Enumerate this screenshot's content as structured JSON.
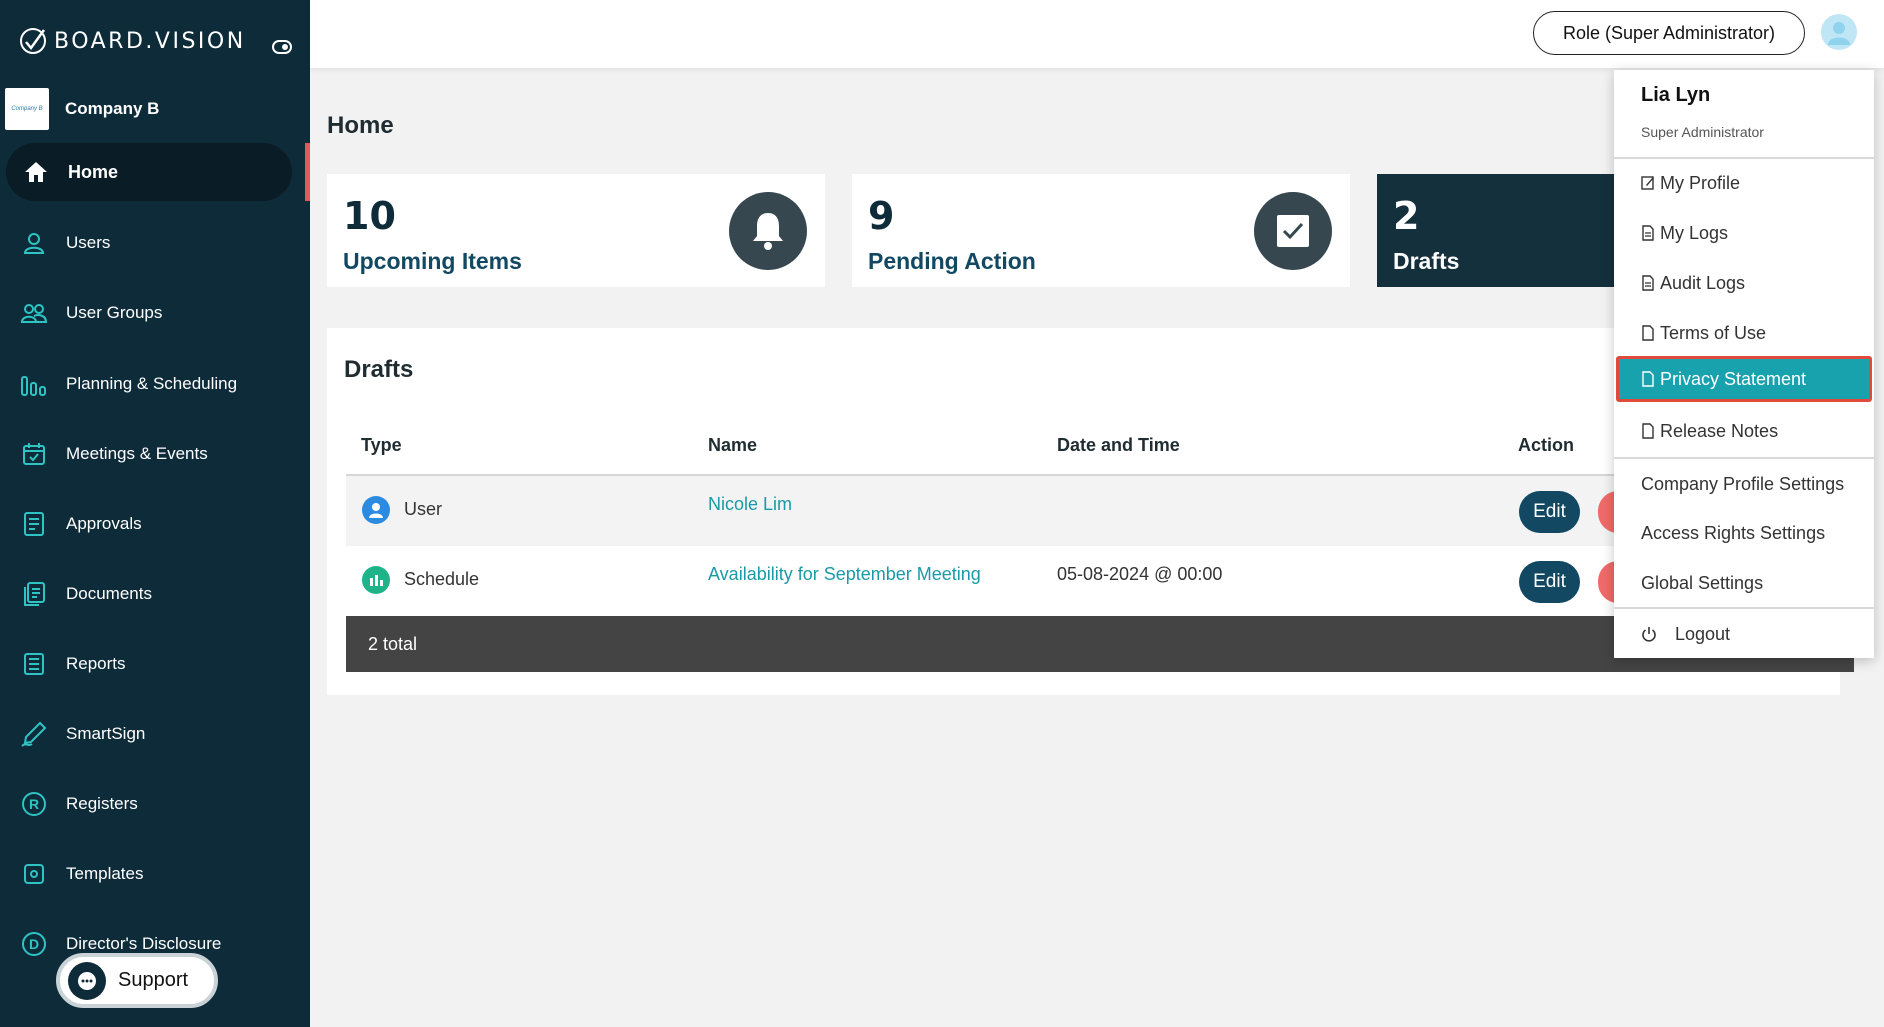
{
  "sidebar": {
    "brand": "BOARD.VISION",
    "company": {
      "logo_text": "Company B",
      "name": "Company B"
    },
    "items": [
      {
        "label": "Home",
        "icon": "home-icon"
      },
      {
        "label": "Users",
        "icon": "user-icon"
      },
      {
        "label": "User Groups",
        "icon": "user-group-icon"
      },
      {
        "label": "Planning & Scheduling",
        "icon": "bar-chart-icon"
      },
      {
        "label": "Meetings & Events",
        "icon": "calendar-icon"
      },
      {
        "label": "Approvals",
        "icon": "approvals-icon"
      },
      {
        "label": "Documents",
        "icon": "documents-icon"
      },
      {
        "label": "Reports",
        "icon": "reports-icon"
      },
      {
        "label": "SmartSign",
        "icon": "pen-icon"
      },
      {
        "label": "Registers",
        "icon": "registers-icon"
      },
      {
        "label": "Templates",
        "icon": "templates-icon"
      },
      {
        "label": "Director's Disclosure",
        "icon": "disclosure-icon"
      }
    ],
    "support_label": "Support"
  },
  "header": {
    "role_label": "Role (Super Administrator)"
  },
  "main": {
    "page_title": "Home",
    "cards": [
      {
        "value": "10",
        "label": "Upcoming Items",
        "icon": "bell-icon"
      },
      {
        "value": "9",
        "label": "Pending Action",
        "icon": "check-icon"
      },
      {
        "value": "2",
        "label": "Drafts"
      }
    ],
    "drafts": {
      "title": "Drafts",
      "columns": [
        "Type",
        "Name",
        "Date and Time",
        "Action"
      ],
      "rows": [
        {
          "type": "User",
          "name": "Nicole Lim",
          "datetime": "",
          "edit": "Edit"
        },
        {
          "type": "Schedule",
          "name": "Availability for September Meeting",
          "datetime": "05-08-2024 @ 00:00",
          "edit": "Edit"
        }
      ],
      "total": "2 total"
    }
  },
  "user_menu": {
    "name": "Lia Lyn",
    "role": "Super Administrator",
    "items": [
      "My Profile",
      "My Logs",
      "Audit Logs",
      "Terms of Use",
      "Privacy Statement",
      "Release Notes"
    ],
    "settings": [
      "Company Profile Settings",
      "Access Rights Settings",
      "Global Settings"
    ],
    "logout": "Logout"
  },
  "colors": {
    "sidebar_bg": "#0e2b3a",
    "accent": "#17a2ae",
    "primary_button": "#124862",
    "danger": "#f06a6a"
  }
}
